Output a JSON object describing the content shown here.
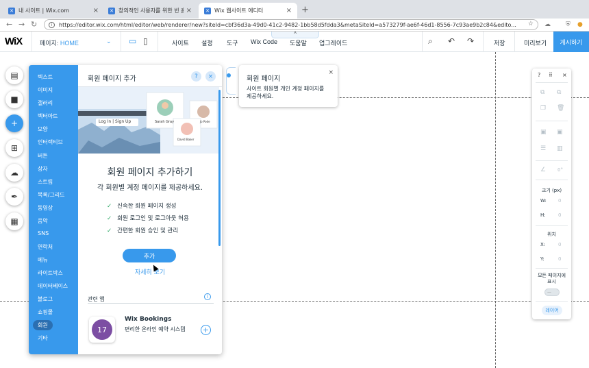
{
  "browser": {
    "tabs": [
      {
        "title": "내 사이트 | Wix.com",
        "active": false
      },
      {
        "title": "창의적인 사용자를 위한 빈 홈페이지",
        "active": false
      },
      {
        "title": "Wix 웹사이트 에디터",
        "active": true
      }
    ],
    "new_tab": "+",
    "url": "https://editor.wix.com/html/editor/web/renderer/new?siteId=cbf36d3a-49d0-41c2-9482-1bb58d5fdda3&metaSiteId=a573279f-ae6f-46d1-8556-7c93ae9b2c84&edito..."
  },
  "toolbar": {
    "logo": "WiX",
    "page_label": "페이지:",
    "page_value": "HOME",
    "menu": [
      "사이트",
      "설정",
      "도구",
      "Wix Code",
      "도움말",
      "업그레이드"
    ],
    "save": "저장",
    "preview": "미리보기",
    "publish": "게시하기"
  },
  "left_rail_icons": [
    "pages-icon",
    "background-icon",
    "add-icon",
    "add-apps-icon",
    "upload-icon",
    "pen-icon",
    "calendar-icon"
  ],
  "add_panel": {
    "categories": [
      "텍스트",
      "이미지",
      "갤러리",
      "벡터아트",
      "모양",
      "인터랙티브",
      "버튼",
      "상자",
      "스트립",
      "목록/그리드",
      "동영상",
      "음악",
      "SNS",
      "연락처",
      "메뉴",
      "라이트박스",
      "데이터베이스",
      "블로그",
      "쇼핑몰",
      "회원",
      "기타"
    ],
    "selected_category": "회원",
    "title": "회원 페이지 추가",
    "hero_login": "Log In | Sign Up",
    "hero_names": [
      "Sarah Gray",
      "David Baker",
      "Jo Pode"
    ],
    "heading": "회원 페이지 추가하기",
    "subheading": "각 회원별 계정 페이지를 제공하세요.",
    "features": [
      "신속한 회원 페이지 생성",
      "회원 로그인 및 로그아웃 허용",
      "간편한 회원 승인 및 관리"
    ],
    "add_button": "추가",
    "more_link": "자세히 보기",
    "related_label": "관련 앱",
    "app": {
      "name": "Wix Bookings",
      "desc": "편리한 온라인 예약 시스템",
      "icon_text": "17"
    }
  },
  "tooltip": {
    "title": "회원 페이지",
    "desc": "사이트 회원별 개인 계정 페이지를 제공하세요."
  },
  "inspector": {
    "angle": "0°",
    "size_label": "크기 (px)",
    "w_label": "W:",
    "w_value": "0",
    "h_label": "H:",
    "h_value": "0",
    "pos_label": "위치",
    "x_label": "X:",
    "x_value": "0",
    "y_label": "Y:",
    "y_value": "0",
    "show_all_label": "모든 페이지에 표시",
    "toggle_text": "—",
    "layers": "레이어"
  },
  "colors": {
    "accent": "#3899ec",
    "check": "#25a55f",
    "bookings": "#7c4ea3"
  }
}
